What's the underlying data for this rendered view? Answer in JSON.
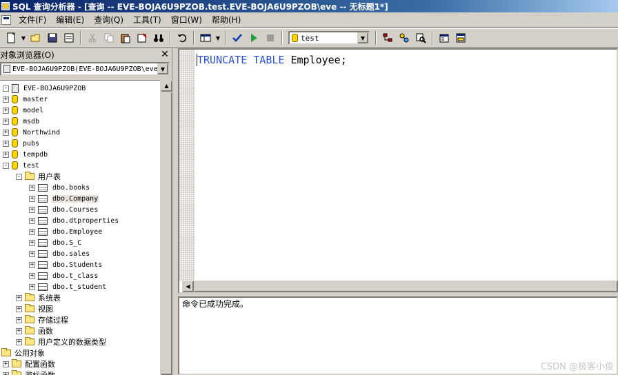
{
  "window": {
    "title": "SQL 查询分析器 - [查询 -- EVE-BOJA6U9PZOB.test.EVE-BOJA6U9PZOB\\eve -- 无标题1*]"
  },
  "menu": {
    "items": [
      "文件(F)",
      "编辑(E)",
      "查询(Q)",
      "工具(T)",
      "窗口(W)",
      "帮助(H)"
    ]
  },
  "toolbar": {
    "database": "test"
  },
  "browser": {
    "title": "对象浏览器(O)",
    "close": "✕",
    "server_combo": "EVE-BOJA6U9PZOB(EVE-BOJA6U9PZOB\\eve)"
  },
  "tree": [
    {
      "label": "EVE-BOJA6U9PZOB",
      "icon": "server-icon",
      "level": 0,
      "expander": "-",
      "cn": false
    },
    {
      "label": "master",
      "icon": "database-icon",
      "level": 0,
      "expander": "+",
      "cn": false
    },
    {
      "label": "model",
      "icon": "database-icon",
      "level": 0,
      "expander": "+",
      "cn": false
    },
    {
      "label": "msdb",
      "icon": "database-icon",
      "level": 0,
      "expander": "+",
      "cn": false
    },
    {
      "label": "Northwind",
      "icon": "database-icon",
      "level": 0,
      "expander": "+",
      "cn": false
    },
    {
      "label": "pubs",
      "icon": "database-icon",
      "level": 0,
      "expander": "+",
      "cn": false
    },
    {
      "label": "tempdb",
      "icon": "database-icon",
      "level": 0,
      "expander": "+",
      "cn": false
    },
    {
      "label": "test",
      "icon": "database-icon",
      "level": 0,
      "expander": "-",
      "cn": false
    },
    {
      "label": "用户表",
      "icon": "folder-icon",
      "level": 1,
      "expander": "-",
      "cn": true
    },
    {
      "label": "dbo.books",
      "icon": "table-icon",
      "level": 2,
      "expander": "+",
      "cn": false
    },
    {
      "label": "dbo.Company",
      "icon": "table-icon",
      "level": 2,
      "expander": "+",
      "cn": false,
      "selected": true
    },
    {
      "label": "dbo.Courses",
      "icon": "table-icon",
      "level": 2,
      "expander": "+",
      "cn": false
    },
    {
      "label": "dbo.dtproperties",
      "icon": "table-icon",
      "level": 2,
      "expander": "+",
      "cn": false
    },
    {
      "label": "dbo.Employee",
      "icon": "table-icon",
      "level": 2,
      "expander": "+",
      "cn": false
    },
    {
      "label": "dbo.S_C",
      "icon": "table-icon",
      "level": 2,
      "expander": "+",
      "cn": false
    },
    {
      "label": "dbo.sales",
      "icon": "table-icon",
      "level": 2,
      "expander": "+",
      "cn": false
    },
    {
      "label": "dbo.Students",
      "icon": "table-icon",
      "level": 2,
      "expander": "+",
      "cn": false
    },
    {
      "label": "dbo.t_class",
      "icon": "table-icon",
      "level": 2,
      "expander": "+",
      "cn": false
    },
    {
      "label": "dbo.t_student",
      "icon": "table-icon",
      "level": 2,
      "expander": "+",
      "cn": false
    },
    {
      "label": "系统表",
      "icon": "folder-icon",
      "level": 1,
      "expander": "+",
      "cn": true
    },
    {
      "label": "视图",
      "icon": "folder-icon",
      "level": 1,
      "expander": "+",
      "cn": true
    },
    {
      "label": "存储过程",
      "icon": "folder-icon",
      "level": 1,
      "expander": "+",
      "cn": true
    },
    {
      "label": "函数",
      "icon": "folder-icon",
      "level": 1,
      "expander": "+",
      "cn": true
    },
    {
      "label": "用户定义的数据类型",
      "icon": "folder-icon",
      "level": 1,
      "expander": "+",
      "cn": true
    },
    {
      "label": "公用对象",
      "icon": "folder-icon",
      "level": -1,
      "expander": "",
      "cn": true
    },
    {
      "label": "配置函数",
      "icon": "folder-icon",
      "level": 0,
      "expander": "+",
      "cn": true
    },
    {
      "label": "游标函数",
      "icon": "folder-icon",
      "level": 0,
      "expander": "+",
      "cn": true
    }
  ],
  "editor": {
    "keyword1": "TRUNCATE",
    "keyword2": "TABLE",
    "identifier": "Employee;",
    "keyword_color": "#2a4fd0"
  },
  "messages": {
    "text": "命令已成功完成。"
  },
  "watermark": "CSDN @极客小俊"
}
